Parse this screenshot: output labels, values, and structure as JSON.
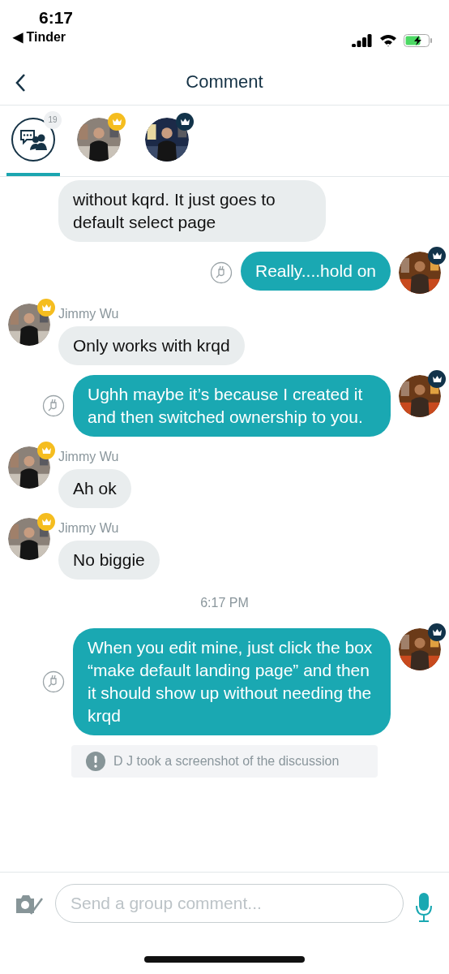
{
  "status_bar": {
    "time": "6:17",
    "back_app": "Tinder",
    "back_glyph": "◀"
  },
  "header": {
    "title": "Comment"
  },
  "tabs": [
    {
      "kind": "group",
      "badge": "19",
      "selected": true
    },
    {
      "kind": "avatar",
      "color": "#f5bd1f",
      "selected": false
    },
    {
      "kind": "avatar",
      "color": "#12334a",
      "selected": false
    }
  ],
  "messages": [
    {
      "kind": "incoming",
      "continued": true,
      "text": "without kqrd. It just goes to default select page"
    },
    {
      "kind": "outgoing",
      "text": "Really....hold on"
    },
    {
      "kind": "incoming",
      "continued": false,
      "sender": "Jimmy Wu",
      "text": "Only works with krqd"
    },
    {
      "kind": "outgoing",
      "text": "Ughh maybe it’s because I created it and then switched ownership to you."
    },
    {
      "kind": "incoming",
      "continued": false,
      "sender": "Jimmy Wu",
      "text": "Ah ok"
    },
    {
      "kind": "incoming",
      "continued": false,
      "sender": "Jimmy Wu",
      "text": "No biggie"
    },
    {
      "kind": "time",
      "text": "6:17 PM"
    },
    {
      "kind": "outgoing",
      "text": "When you edit mine, just click the box “make default landing page” and then it should show up without needing the krqd"
    },
    {
      "kind": "notice",
      "text": "D J took a screenshot of the discussion"
    }
  ],
  "composer": {
    "placeholder": "Send a group comment..."
  }
}
